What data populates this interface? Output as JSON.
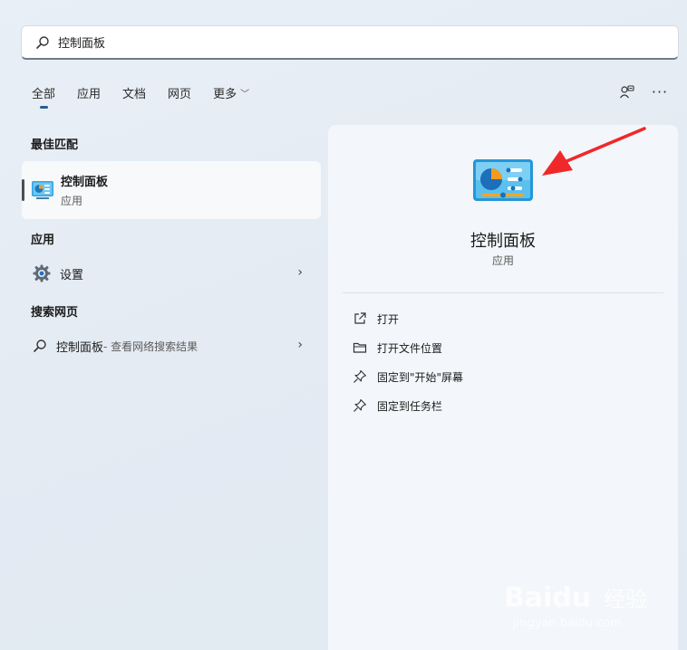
{
  "search": {
    "value": "控制面板"
  },
  "tabs": [
    {
      "label": "全部"
    },
    {
      "label": "应用"
    },
    {
      "label": "文档"
    },
    {
      "label": "网页"
    },
    {
      "label": "更多"
    }
  ],
  "sections": {
    "best_match": "最佳匹配",
    "apps": "应用",
    "web": "搜索网页"
  },
  "best_match": {
    "name": "控制面板",
    "type": "应用"
  },
  "apps": [
    {
      "label": "设置"
    }
  ],
  "web_result": {
    "query": "控制面板",
    "hint": " - 查看网络搜索结果"
  },
  "detail": {
    "title": "控制面板",
    "subtitle": "应用",
    "actions": [
      {
        "label": "打开",
        "icon": "open-external-icon"
      },
      {
        "label": "打开文件位置",
        "icon": "folder-icon"
      },
      {
        "label": "固定到\"开始\"屏幕",
        "icon": "pin-icon"
      },
      {
        "label": "固定到任务栏",
        "icon": "pin-icon"
      }
    ]
  },
  "watermark": {
    "brand": "Baidu",
    "cn": "经验",
    "url": "jingyan.baidu.com"
  },
  "colors": {
    "accent": "#2a5d8f",
    "arrow": "#f0282a"
  }
}
